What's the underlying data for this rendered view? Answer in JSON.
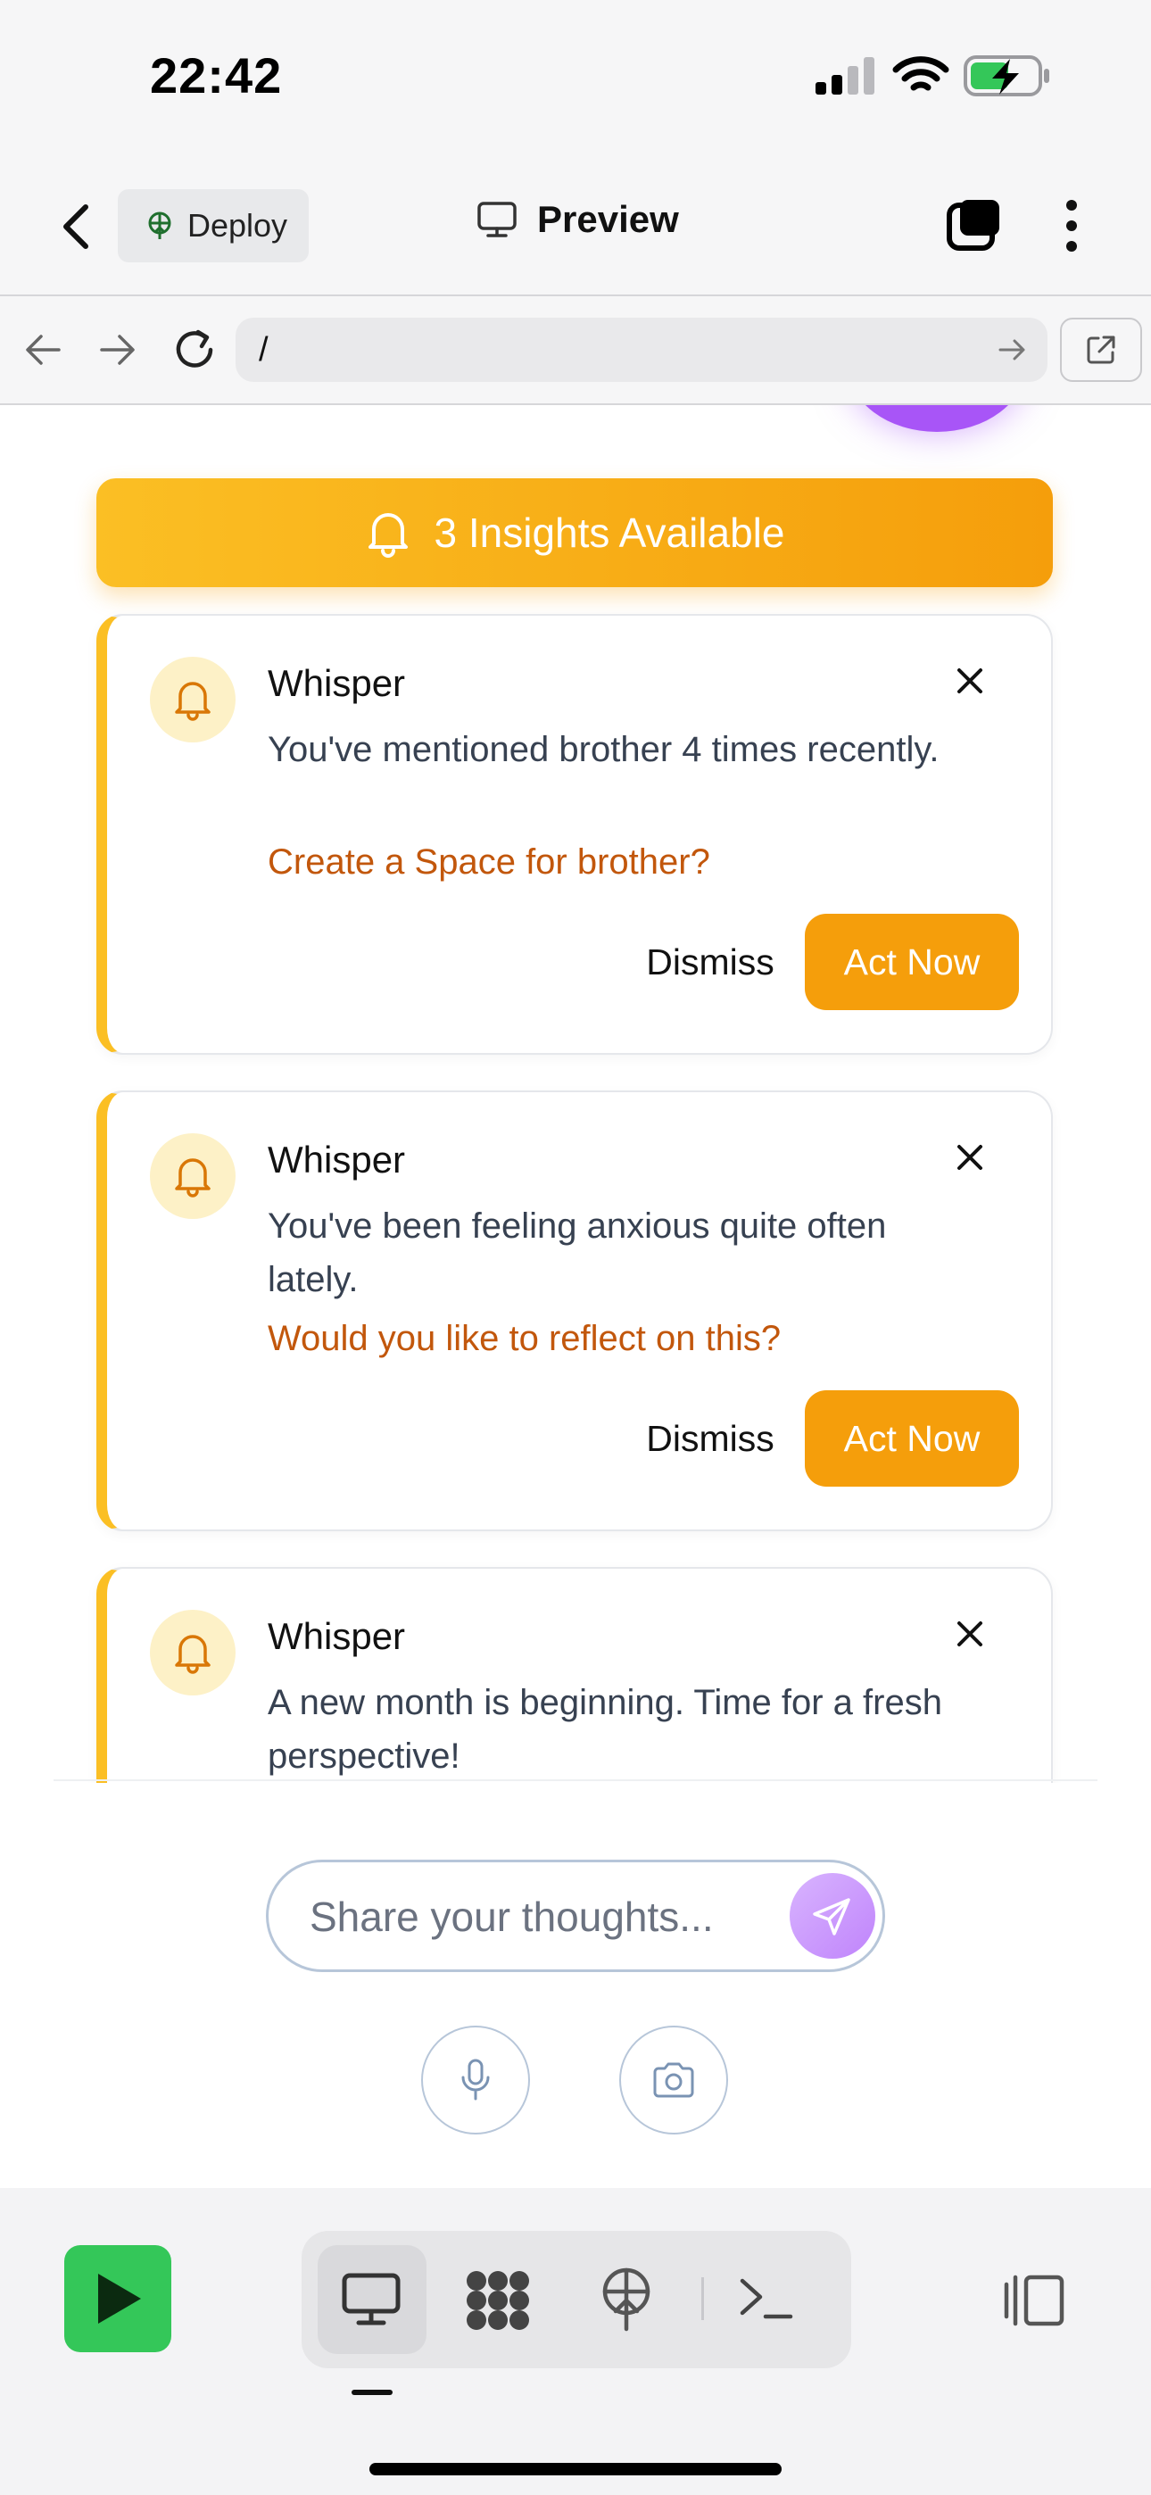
{
  "status_bar": {
    "time": "22:42"
  },
  "app_bar": {
    "deploy_label": "Deploy",
    "preview_label": "Preview"
  },
  "browser": {
    "url": "/"
  },
  "banner": {
    "text": "3 Insights Available"
  },
  "insights": [
    {
      "title": "Whisper",
      "message": "You've mentioned brother 4 times recently.",
      "cta": "Create a Space for brother?",
      "dismiss_label": "Dismiss",
      "act_label": "Act Now"
    },
    {
      "title": "Whisper",
      "message": "You've been feeling anxious quite often lately.",
      "cta": "Would you like to reflect on this?",
      "dismiss_label": "Dismiss",
      "act_label": "Act Now"
    },
    {
      "title": "Whisper",
      "message": "A new month is beginning. Time for a fresh perspective!"
    }
  ],
  "composer": {
    "placeholder": "Share your thoughts..."
  },
  "colors": {
    "accent_amber": "#f59e0b",
    "amber_light": "#fbbf24",
    "cta_text": "#c2570c",
    "send_purple": "#c084fc",
    "run_green": "#34c759"
  },
  "icons": {
    "back": "chevron-left-icon",
    "deploy": "globe-upload-icon",
    "preview": "monitor-icon",
    "tabs": "tabs-square-icon",
    "menu": "more-vertical-icon",
    "nav_back": "arrow-left-icon",
    "nav_forward": "arrow-right-icon",
    "reload": "reload-icon",
    "go": "arrow-right-icon",
    "open_external": "external-link-icon",
    "bell": "bell-icon",
    "close": "close-icon",
    "send": "send-icon",
    "mic": "microphone-icon",
    "camera": "camera-icon",
    "run": "play-icon",
    "toolbar_preview": "monitor-icon",
    "toolbar_workspace": "blocks-icon",
    "toolbar_deploy": "globe-upload-icon",
    "toolbar_shell": "terminal-icon",
    "toolbar_layout": "panel-layout-icon"
  }
}
